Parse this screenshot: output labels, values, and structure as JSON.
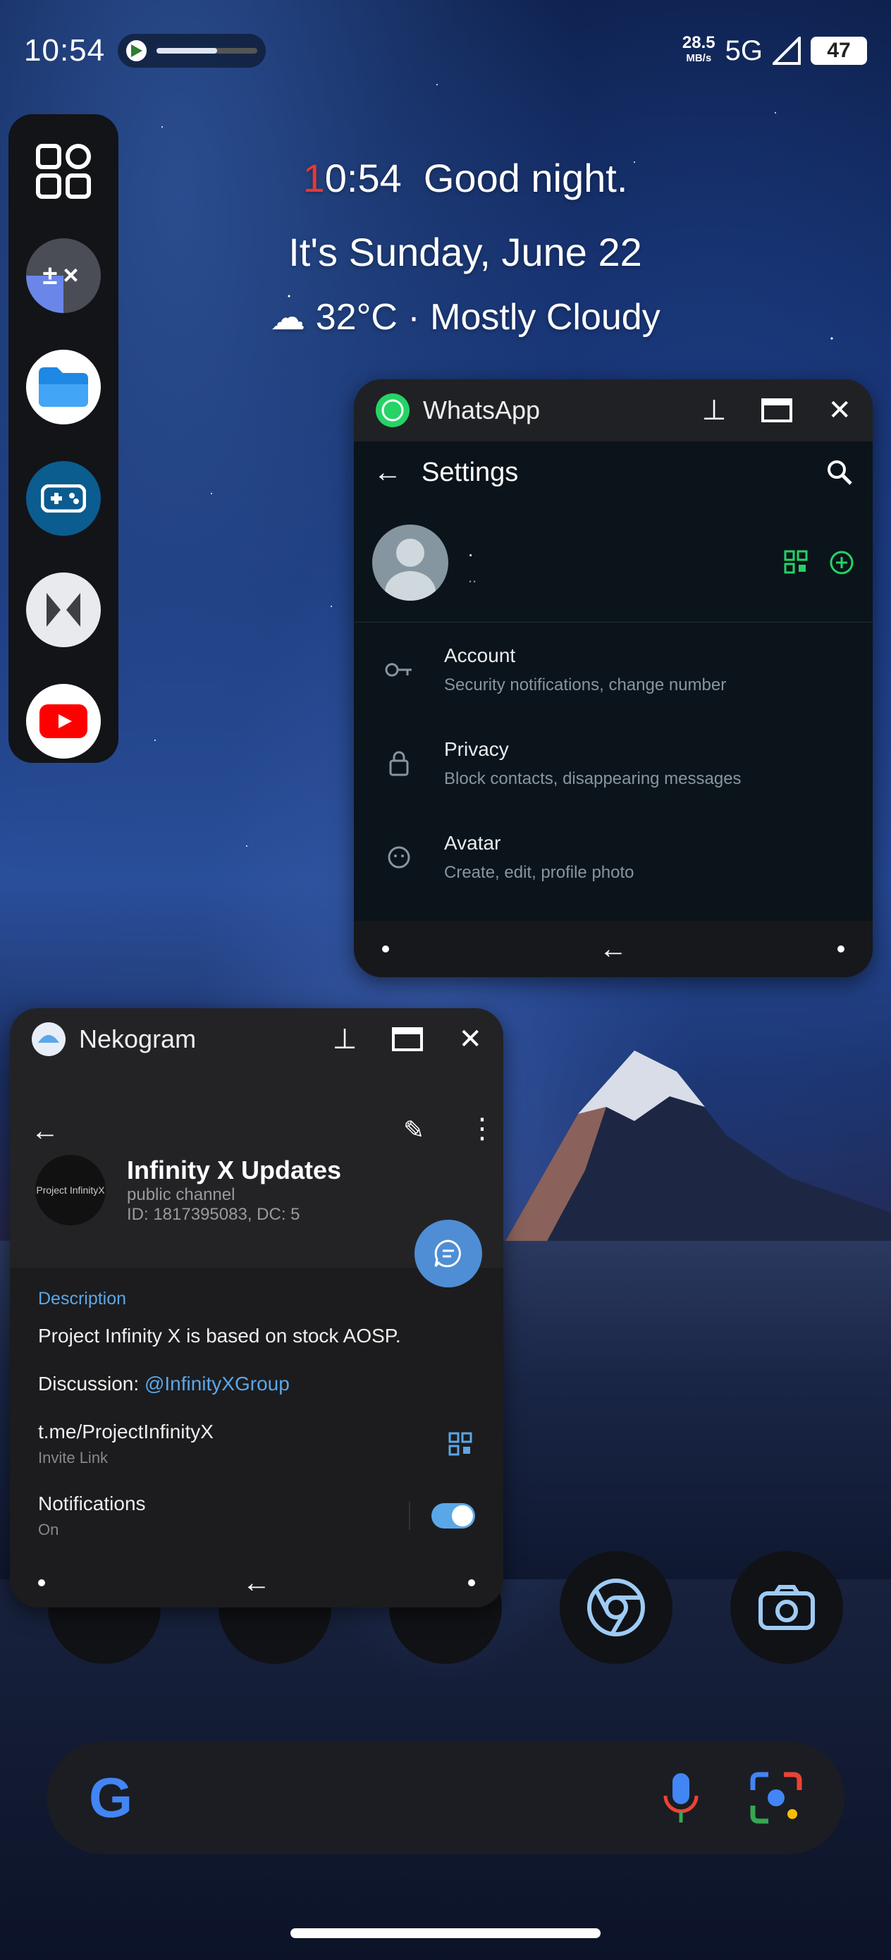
{
  "status_bar": {
    "time": "10:54",
    "media_progress": 0.6,
    "net_speed": "28.5",
    "net_speed_unit": "MB/s",
    "network": "5G",
    "battery": "47"
  },
  "widget": {
    "time_first": "1",
    "time_rest": "0:54",
    "greeting": "Good night.",
    "date": "It's Sunday, June 22",
    "weather": "32°C · Mostly Cloudy"
  },
  "dock": {
    "icons": [
      "grid-icon",
      "calculator-icon",
      "files-icon",
      "game-controller-icon",
      "app-icon",
      "youtube-icon"
    ]
  },
  "whatsapp": {
    "title": "WhatsApp",
    "screen_title": "Settings",
    "profile_name": ".",
    "profile_status": "..",
    "items": [
      {
        "title": "Account",
        "subtitle": "Security notifications, change number"
      },
      {
        "title": "Privacy",
        "subtitle": "Block contacts, disappearing messages"
      },
      {
        "title": "Avatar",
        "subtitle": "Create, edit, profile photo"
      }
    ]
  },
  "nekogram": {
    "title": "Nekogram",
    "channel_logo_text": "Project InfinityX",
    "channel_name": "Infinity X Updates",
    "channel_type": "public channel",
    "channel_id": "ID: 1817395083, DC: 5",
    "description_label": "Description",
    "description": "Project Infinity X is based on stock AOSP.",
    "discussion_label": "Discussion:",
    "discussion_link": "@InfinityXGroup",
    "invite_link": "t.me/ProjectInfinityX",
    "invite_link_label": "Invite Link",
    "notifications_label": "Notifications",
    "notifications_state": "On"
  },
  "colors": {
    "whatsapp_green": "#25d366",
    "telegram_blue": "#5aa7e8"
  }
}
